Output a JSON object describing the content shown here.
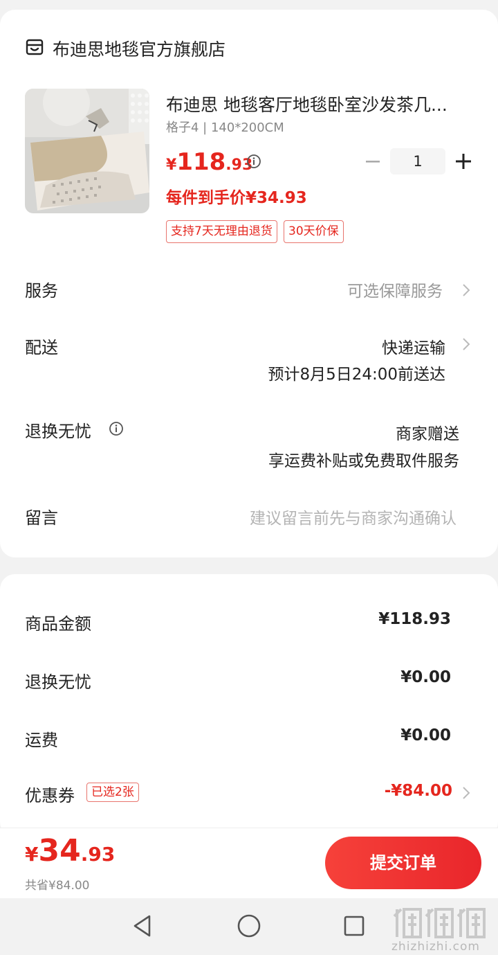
{
  "store": {
    "name": "布迪思地毯官方旗舰店",
    "icon": "store-icon"
  },
  "product": {
    "title": "布迪思 地毯客厅地毯卧室沙发茶几...",
    "spec": "格子4 | 140*200CM",
    "price_symbol": "¥",
    "price_int": "118",
    "price_dec": ".93",
    "unit_price_label": "每件到手价¥34.93",
    "quantity": "1",
    "tags": [
      "支持7天无理由退货",
      "30天价保"
    ]
  },
  "rows": {
    "service": {
      "label": "服务",
      "value": "可选保障服务"
    },
    "delivery": {
      "label": "配送",
      "value": "快递运输",
      "eta": "预计8月5日24:00前送达"
    },
    "return": {
      "label": "退换无忧",
      "value": "商家赠送",
      "detail": "享运费补贴或免费取件服务"
    },
    "message": {
      "label": "留言",
      "placeholder": "建议留言前先与商家沟通确认"
    }
  },
  "summary": {
    "goods_amount": {
      "label": "商品金额",
      "value": "¥118.93"
    },
    "return_care": {
      "label": "退换无忧",
      "value": "¥0.00"
    },
    "shipping": {
      "label": "运费",
      "value": "¥0.00"
    },
    "coupon": {
      "label": "优惠券",
      "badge": "已选2张",
      "value": "-¥84.00"
    }
  },
  "footer": {
    "total_symbol": "¥",
    "total_int": "34",
    "total_dec": ".93",
    "saved_label": "共省¥84.00",
    "submit_label": "提交订单"
  },
  "watermark": {
    "logo": "值值值",
    "text": "zhizhizhi.com"
  },
  "colors": {
    "accent": "#e5261e",
    "muted": "#999999",
    "background": "#f2f2f2"
  }
}
